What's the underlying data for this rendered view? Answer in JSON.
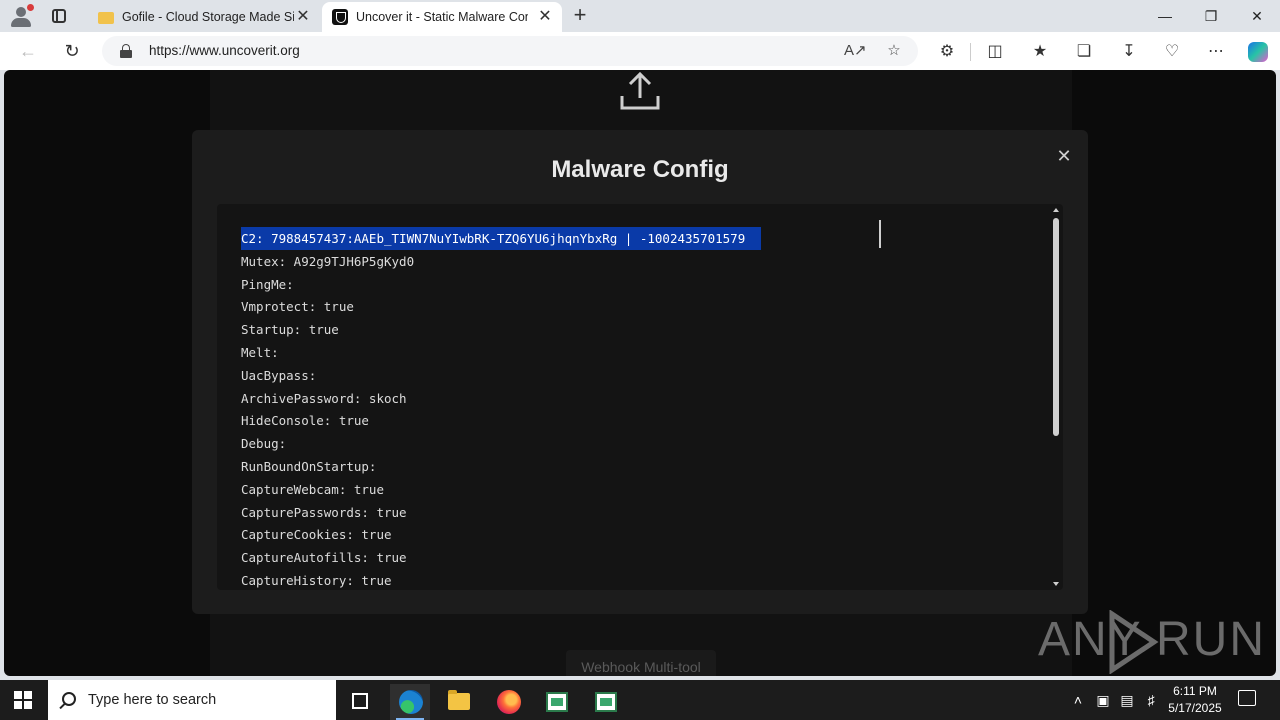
{
  "browser": {
    "tabs": [
      {
        "title": "Gofile - Cloud Storage Made Simple",
        "active": false
      },
      {
        "title": "Uncover it - Static Malware Config",
        "active": true
      }
    ],
    "url": "https://www.uncoverit.org",
    "new_tab_glyph": "+",
    "close_glyph": "✕"
  },
  "modal": {
    "title": "Malware Config",
    "close_glyph": "✕",
    "selected_line": "C2: 7988457437:AAEb_TIWN7NuYIwbRK-TZQ6YU6jhqnYbxRg | -1002435701579",
    "lines": [
      "Mutex: A92g9TJH6P5gKyd0",
      "PingMe:",
      "Vmprotect: true",
      "Startup: true",
      "Melt:",
      "UacBypass:",
      "ArchivePassword: skoch",
      "HideConsole: true",
      "Debug:",
      "RunBoundOnStartup:",
      "CaptureWebcam: true",
      "CapturePasswords: true",
      "CaptureCookies: true",
      "CaptureAutofills: true",
      "CaptureHistory: true"
    ]
  },
  "background": {
    "footer_button": "Webhook Multi-tool"
  },
  "watermark": {
    "left": "ANY",
    "right": "RUN"
  },
  "taskbar": {
    "search_placeholder": "Type here to search",
    "time": "6:11 PM",
    "date": "5/17/2025"
  },
  "colors": {
    "selection": "#0a3aa8",
    "modal_bg": "#1c1c1c",
    "page_bg": "#0b0b0b"
  }
}
